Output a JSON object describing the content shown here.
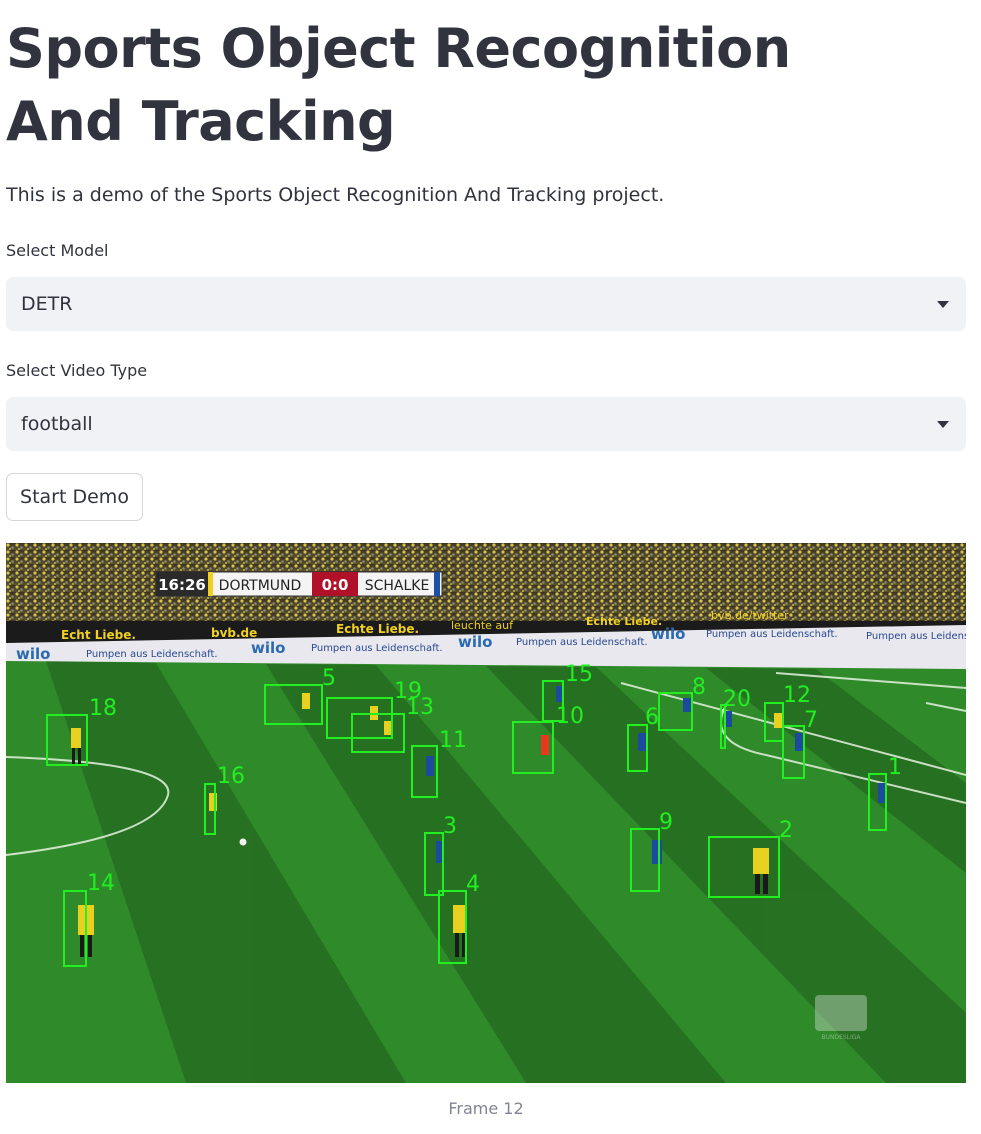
{
  "title": "Sports Object Recognition And Tracking",
  "description": "This is a demo of the Sports Object Recognition And Tracking project.",
  "model_select": {
    "label": "Select Model",
    "value": "DETR",
    "icon": "chevron-down-icon"
  },
  "video_select": {
    "label": "Select Video Type",
    "value": "football",
    "icon": "chevron-down-icon"
  },
  "start_button": {
    "label": "Start Demo"
  },
  "video_frame": {
    "scoreboard": {
      "time": "16:26",
      "home": "DORTMUND",
      "score": "0:0",
      "away": "SCHALKE"
    },
    "ad_texts": [
      "Echt Liebe.",
      "bvb.de",
      "Echte Liebe.",
      "leuchte auf",
      "Echte Liebe.",
      "bvb.de/twitter",
      "wilo",
      "Pumpen aus Leidenschaft.",
      "wilo",
      "Pumpen aus Leidenschaft.",
      "wilo",
      "Pumpen aus Leidenschaft.",
      "wilo",
      "Pumpen aus Leidenschaft.",
      "Pumpen aus Leidenschaft."
    ],
    "watermark": "BUNDESLIGA",
    "box_color": "#22ee22",
    "track_ids": [
      "18",
      "5",
      "19",
      "13",
      "11",
      "16",
      "15",
      "10",
      "6",
      "8",
      "20",
      "12",
      "7",
      "1",
      "3",
      "9",
      "2",
      "14",
      "4"
    ]
  },
  "caption": "Frame 12",
  "colors": {
    "accent_bg": "#f0f2f6",
    "text": "#31333f",
    "caption": "#808495"
  }
}
